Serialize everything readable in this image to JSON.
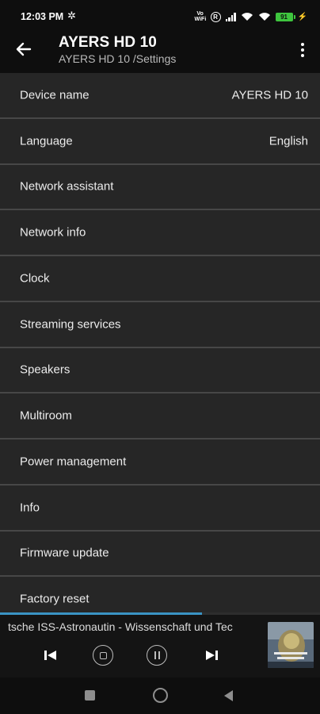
{
  "status_bar": {
    "time": "12:03 PM",
    "settings_icon": "gear-icon",
    "vowifi_top": "Vo",
    "vowifi_bottom": "WiFi",
    "r_label": "R",
    "battery_level": "91",
    "charging_icon": "bolt-icon"
  },
  "app_bar": {
    "back_icon": "arrow-back-icon",
    "title": "AYERS HD 10",
    "subtitle": "AYERS HD 10 /Settings",
    "more_icon": "more-vert-icon"
  },
  "settings": {
    "items": [
      {
        "label": "Device name",
        "value": "AYERS HD 10"
      },
      {
        "label": "Language",
        "value": "English"
      },
      {
        "label": "Network assistant",
        "value": ""
      },
      {
        "label": "Network info",
        "value": ""
      },
      {
        "label": "Clock",
        "value": ""
      },
      {
        "label": "Streaming services",
        "value": ""
      },
      {
        "label": "Speakers",
        "value": ""
      },
      {
        "label": "Multiroom",
        "value": ""
      },
      {
        "label": "Power management",
        "value": ""
      },
      {
        "label": "Info",
        "value": ""
      },
      {
        "label": "Firmware update",
        "value": ""
      },
      {
        "label": "Factory reset",
        "value": ""
      }
    ]
  },
  "player": {
    "now_playing": "tsche ISS-Astronautin - Wissenschaft und Tec",
    "progress": 0.63,
    "accent_color": "#3a93c4",
    "controls": [
      "skip-previous-icon",
      "stop-icon",
      "pause-icon",
      "skip-next-icon"
    ]
  },
  "nav_bar": {
    "icons": [
      "recents-square-icon",
      "home-circle-icon",
      "back-triangle-icon"
    ]
  }
}
